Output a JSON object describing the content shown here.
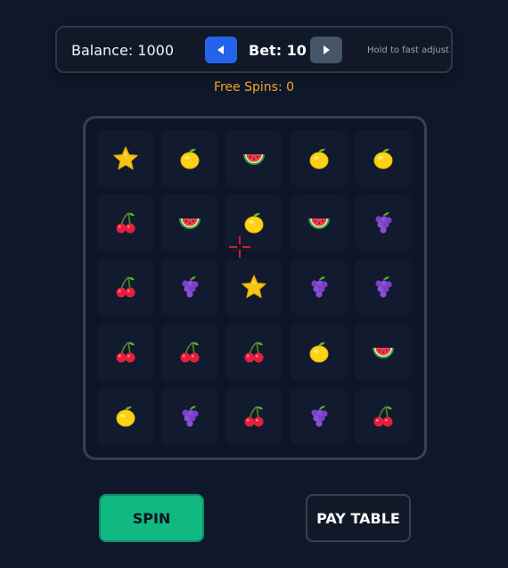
{
  "topbar": {
    "balance_text": "Balance: 1000",
    "bet_text": "Bet: 10",
    "hint_text": "Hold to fast adjust",
    "decrease_icon": "triangle-left-icon",
    "increase_icon": "triangle-right-icon"
  },
  "free_spins_text": "Free Spins: 0",
  "grid": {
    "rows": 5,
    "cols": 5,
    "cells": [
      [
        "star",
        "lemon",
        "watermelon",
        "lemon",
        "lemon"
      ],
      [
        "cherry",
        "watermelon",
        "lemon",
        "watermelon",
        "grapes"
      ],
      [
        "cherry",
        "grapes",
        "star",
        "grapes",
        "grapes"
      ],
      [
        "cherry",
        "cherry",
        "cherry",
        "lemon",
        "watermelon"
      ],
      [
        "lemon",
        "grapes",
        "cherry",
        "grapes",
        "cherry"
      ]
    ]
  },
  "buttons": {
    "spin_label": "SPIN",
    "paytable_label": "PAY TABLE"
  },
  "colors": {
    "background": "#0f172a",
    "accent_blue": "#2563eb",
    "spin_green": "#10b981",
    "free_spins_amber": "#f5a524"
  }
}
